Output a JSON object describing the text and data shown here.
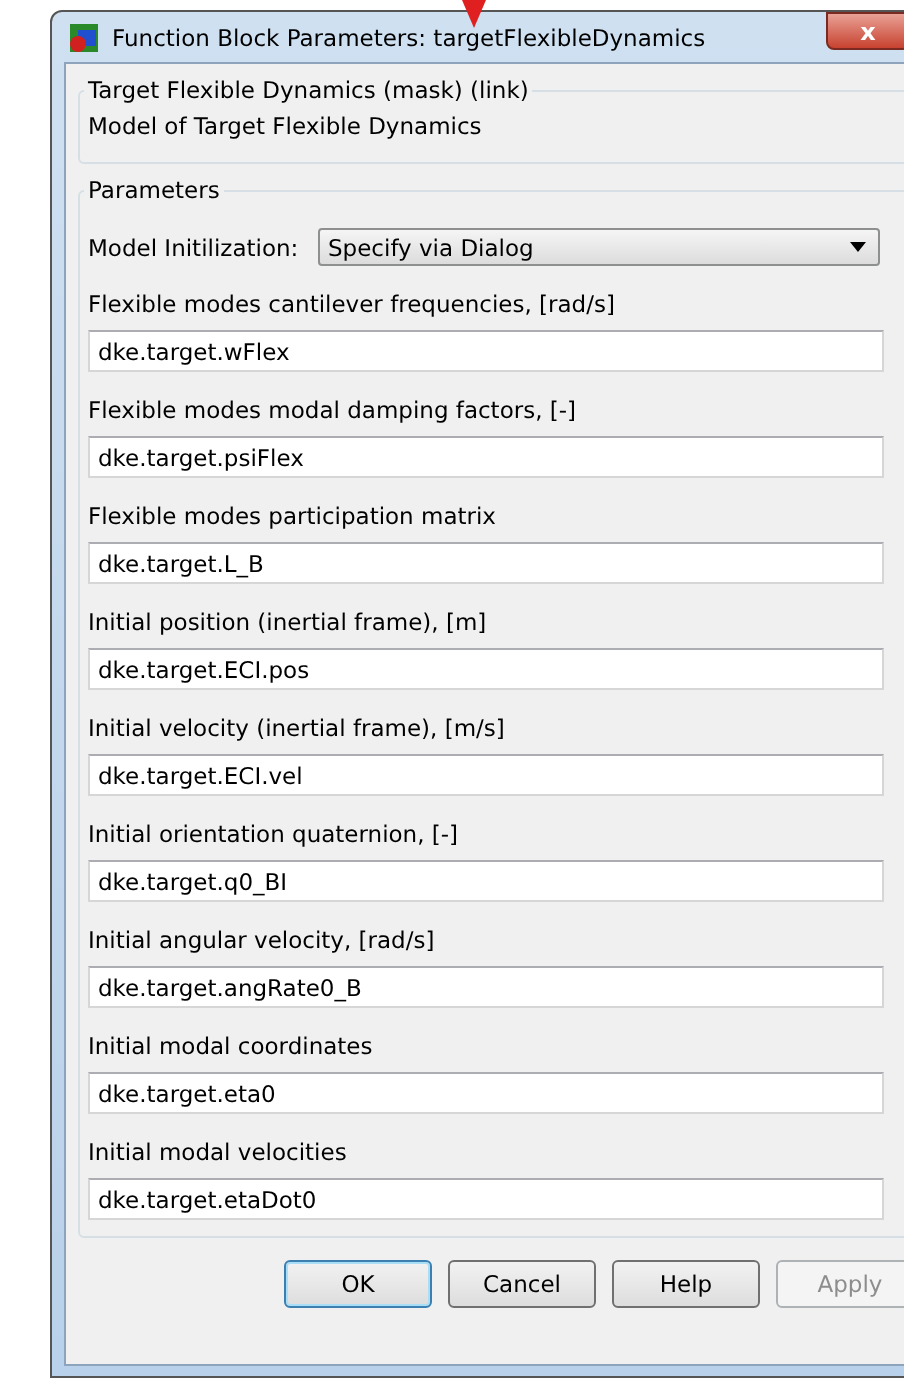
{
  "window": {
    "title": "Function Block Parameters: targetFlexibleDynamics",
    "close": "x"
  },
  "description": {
    "title": "Target Flexible Dynamics (mask) (link)",
    "text": "Model of Target Flexible Dynamics"
  },
  "parameters": {
    "title": "Parameters",
    "dropdown": {
      "label": "Model Initilization:",
      "value": "Specify via Dialog"
    },
    "fields": [
      {
        "label": "Flexible modes cantilever frequencies, [rad/s]",
        "value": "dke.target.wFlex"
      },
      {
        "label": "Flexible modes modal damping factors, [-]",
        "value": "dke.target.psiFlex"
      },
      {
        "label": "Flexible modes participation matrix",
        "value": "dke.target.L_B"
      },
      {
        "label": "Initial position (inertial frame), [m]",
        "value": "dke.target.ECI.pos"
      },
      {
        "label": "Initial velocity (inertial frame), [m/s]",
        "value": "dke.target.ECI.vel"
      },
      {
        "label": "Initial orientation quaternion, [-]",
        "value": "dke.target.q0_BI"
      },
      {
        "label": "Initial angular velocity, [rad/s]",
        "value": "dke.target.angRate0_B"
      },
      {
        "label": "Initial modal coordinates",
        "value": "dke.target.eta0"
      },
      {
        "label": "Initial modal velocities",
        "value": "dke.target.etaDot0"
      }
    ]
  },
  "buttons": [
    {
      "label": "OK",
      "disabled": false,
      "selected": true
    },
    {
      "label": "Cancel",
      "disabled": false,
      "selected": false
    },
    {
      "label": "Help",
      "disabled": false,
      "selected": false
    },
    {
      "label": "Apply",
      "disabled": true,
      "selected": false
    }
  ]
}
